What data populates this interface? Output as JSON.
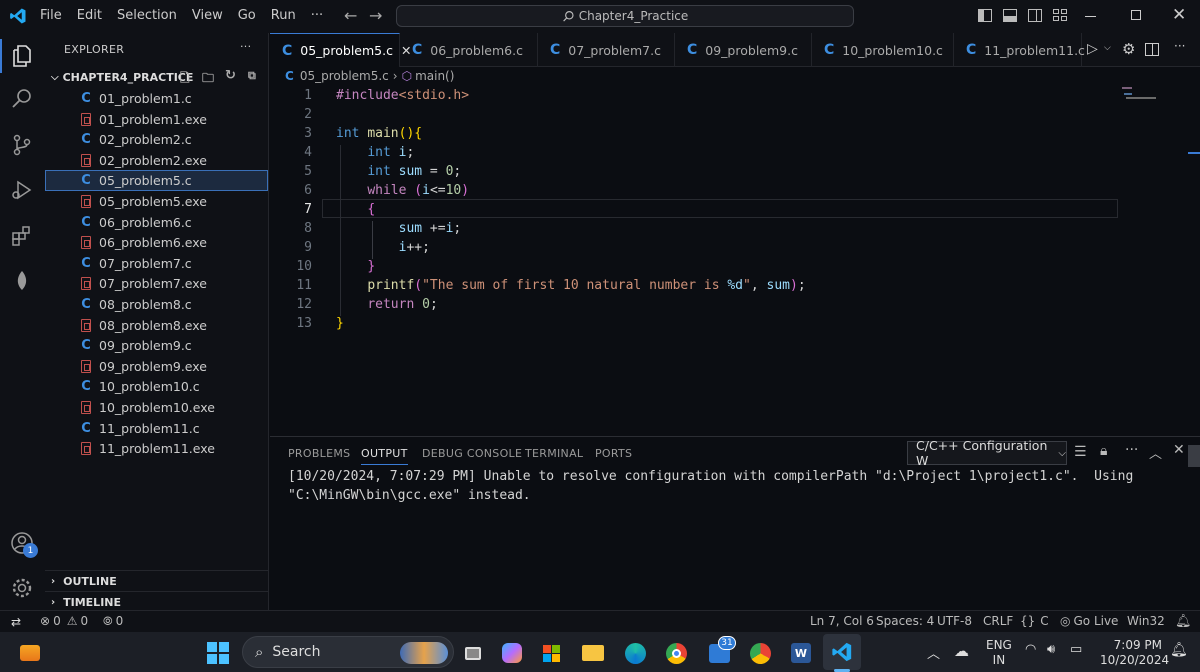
{
  "menu": [
    "File",
    "Edit",
    "Selection",
    "View",
    "Go",
    "Run"
  ],
  "menu_more": "···",
  "search": {
    "text": "Chapter4_Practice"
  },
  "explorer": {
    "title": "EXPLORER",
    "folder": "CHAPTER4_PRACTICE",
    "files": [
      {
        "name": "01_problem1.c",
        "type": "c"
      },
      {
        "name": "01_problem1.exe",
        "type": "exe"
      },
      {
        "name": "02_problem2.c",
        "type": "c"
      },
      {
        "name": "02_problem2.exe",
        "type": "exe"
      },
      {
        "name": "05_problem5.c",
        "type": "c",
        "selected": true
      },
      {
        "name": "05_problem5.exe",
        "type": "exe"
      },
      {
        "name": "06_problem6.c",
        "type": "c"
      },
      {
        "name": "06_problem6.exe",
        "type": "exe"
      },
      {
        "name": "07_problem7.c",
        "type": "c"
      },
      {
        "name": "07_problem7.exe",
        "type": "exe"
      },
      {
        "name": "08_problem8.c",
        "type": "c"
      },
      {
        "name": "08_problem8.exe",
        "type": "exe"
      },
      {
        "name": "09_problem9.c",
        "type": "c"
      },
      {
        "name": "09_problem9.exe",
        "type": "exe"
      },
      {
        "name": "10_problem10.c",
        "type": "c"
      },
      {
        "name": "10_problem10.exe",
        "type": "exe"
      },
      {
        "name": "11_problem11.c",
        "type": "c"
      },
      {
        "name": "11_problem11.exe",
        "type": "exe"
      }
    ],
    "outline": "OUTLINE",
    "timeline": "TIMELINE"
  },
  "tabs": [
    {
      "label": "05_problem5.c",
      "active": true
    },
    {
      "label": "06_problem6.c"
    },
    {
      "label": "07_problem7.c"
    },
    {
      "label": "09_problem9.c"
    },
    {
      "label": "10_problem10.c"
    },
    {
      "label": "11_problem11.c"
    }
  ],
  "breadcrumb": {
    "file": "05_problem5.c",
    "symbol": "main()"
  },
  "editor": {
    "current_line": 7,
    "line_numbers": [
      "1",
      "2",
      "3",
      "4",
      "5",
      "6",
      "7",
      "8",
      "9",
      "10",
      "11",
      "12",
      "13"
    ]
  },
  "panel": {
    "tabs": [
      "PROBLEMS",
      "OUTPUT",
      "DEBUG CONSOLE",
      "TERMINAL",
      "PORTS"
    ],
    "active_tab": "OUTPUT",
    "output_channel": "C/C++ Configuration W",
    "lines": [
      "[10/20/2024, 7:07:29 PM] Unable to resolve configuration with compilerPath \"d:\\Project 1\\project1.c\".  Using",
      "\"C:\\MinGW\\bin\\gcc.exe\" instead."
    ]
  },
  "status": {
    "errors": "0",
    "warnings": "0",
    "ports": "0",
    "position": "Ln 7, Col 6",
    "spaces": "Spaces: 4",
    "encoding": "UTF-8",
    "eol": "CRLF",
    "language": "C",
    "golive": "Go Live",
    "platform": "Win32"
  },
  "accounts_badge": "1",
  "taskbar": {
    "search": "Search",
    "calendar_badge": "31",
    "lang": "ENG",
    "region": "IN",
    "time": "7:09 PM",
    "date": "10/20/2024"
  },
  "colors": {
    "accent": "#3a7bd5",
    "c_icon": "#3d8ee0",
    "exe_icon": "#c0504d",
    "vscode_blue": "#23a9f2"
  }
}
